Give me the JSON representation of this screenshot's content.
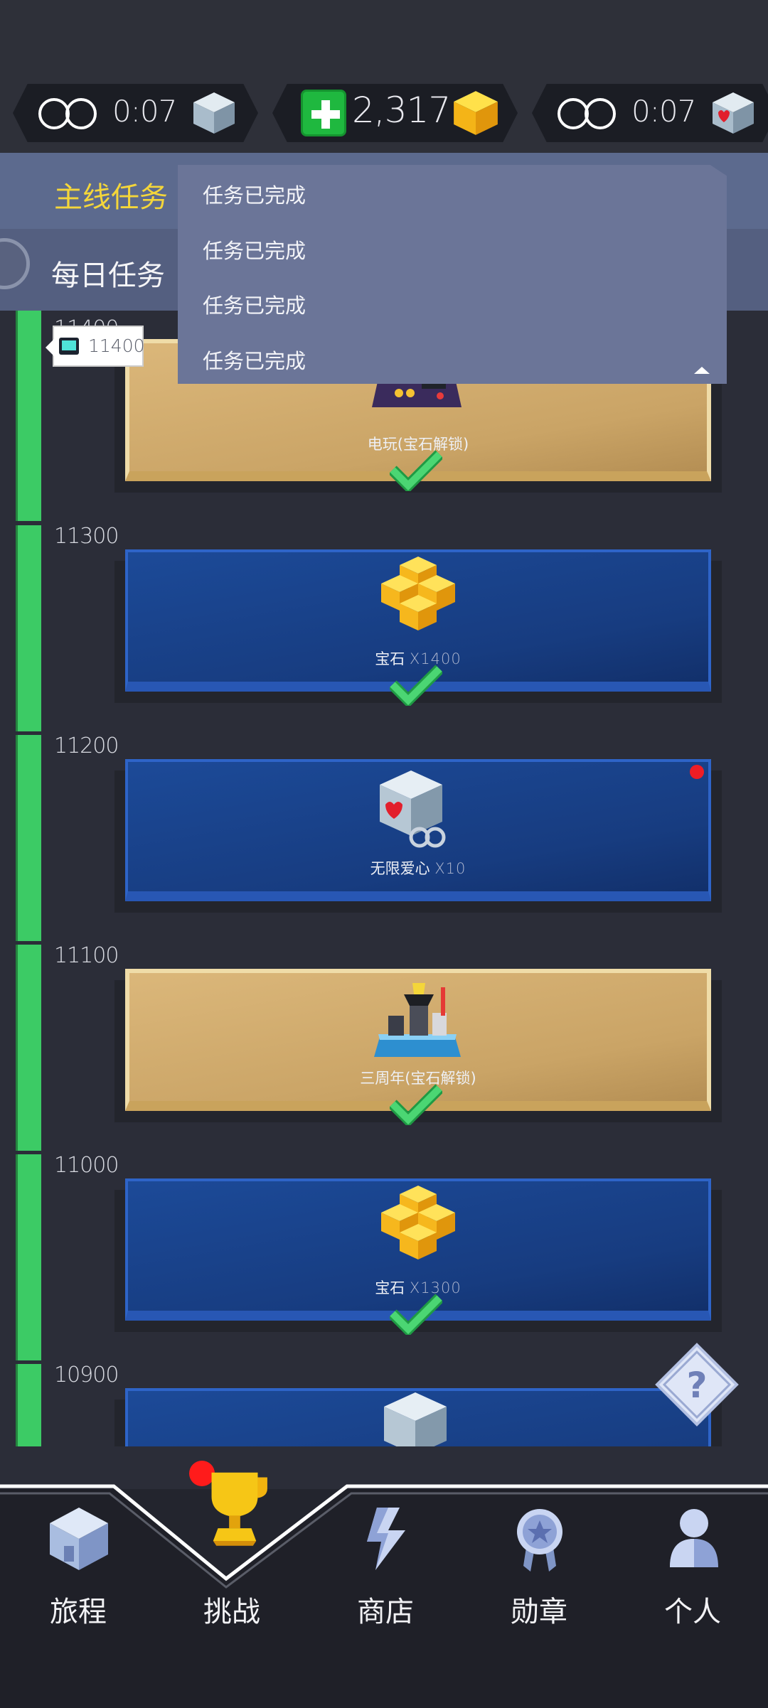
{
  "resources": {
    "left_timer": "0:07",
    "gems": "2,317",
    "right_timer": "0:07"
  },
  "tasks": {
    "main_label": "主线任务",
    "daily_label": "每日任务",
    "dropdown_items": [
      "任务已完成",
      "任务已完成",
      "任务已完成",
      "任务已完成"
    ]
  },
  "progress": {
    "current_marker": "11400",
    "rows": [
      {
        "level": "11400",
        "card": "gold",
        "title": "电玩(宝石解锁)",
        "qty": "",
        "completed": true,
        "icon": "arcade-level-icon"
      },
      {
        "level": "11300",
        "card": "blue",
        "title": "宝石",
        "qty": "X1400",
        "completed": true,
        "icon": "gem-cluster-icon"
      },
      {
        "level": "11200",
        "card": "blue",
        "title": "无限爱心",
        "qty": "X10",
        "completed": false,
        "icon": "infinite-heart-cube-icon",
        "new": true
      },
      {
        "level": "11100",
        "card": "gold",
        "title": "三周年(宝石解锁)",
        "qty": "",
        "completed": true,
        "icon": "anniversary-level-icon"
      },
      {
        "level": "11000",
        "card": "blue",
        "title": "宝石",
        "qty": "X1300",
        "completed": true,
        "icon": "gem-cluster-icon"
      },
      {
        "level": "10900",
        "card": "blue",
        "title": "",
        "qty": "",
        "completed": false,
        "icon": "cube-icon"
      }
    ]
  },
  "nav": {
    "tabs": [
      {
        "label": "旅程",
        "icon": "house-icon"
      },
      {
        "label": "挑战",
        "icon": "trophy-icon",
        "active": true,
        "badge": true
      },
      {
        "label": "商店",
        "icon": "shop-lightning-icon"
      },
      {
        "label": "勋章",
        "icon": "medal-icon"
      },
      {
        "label": "个人",
        "icon": "person-icon"
      }
    ]
  },
  "colors": {
    "accent_yellow": "#f4d63a",
    "progress_green": "#3ccb65",
    "card_blue": "#1c4a98",
    "card_gold": "#dbb77a",
    "alert_red": "#ff1b1b"
  }
}
